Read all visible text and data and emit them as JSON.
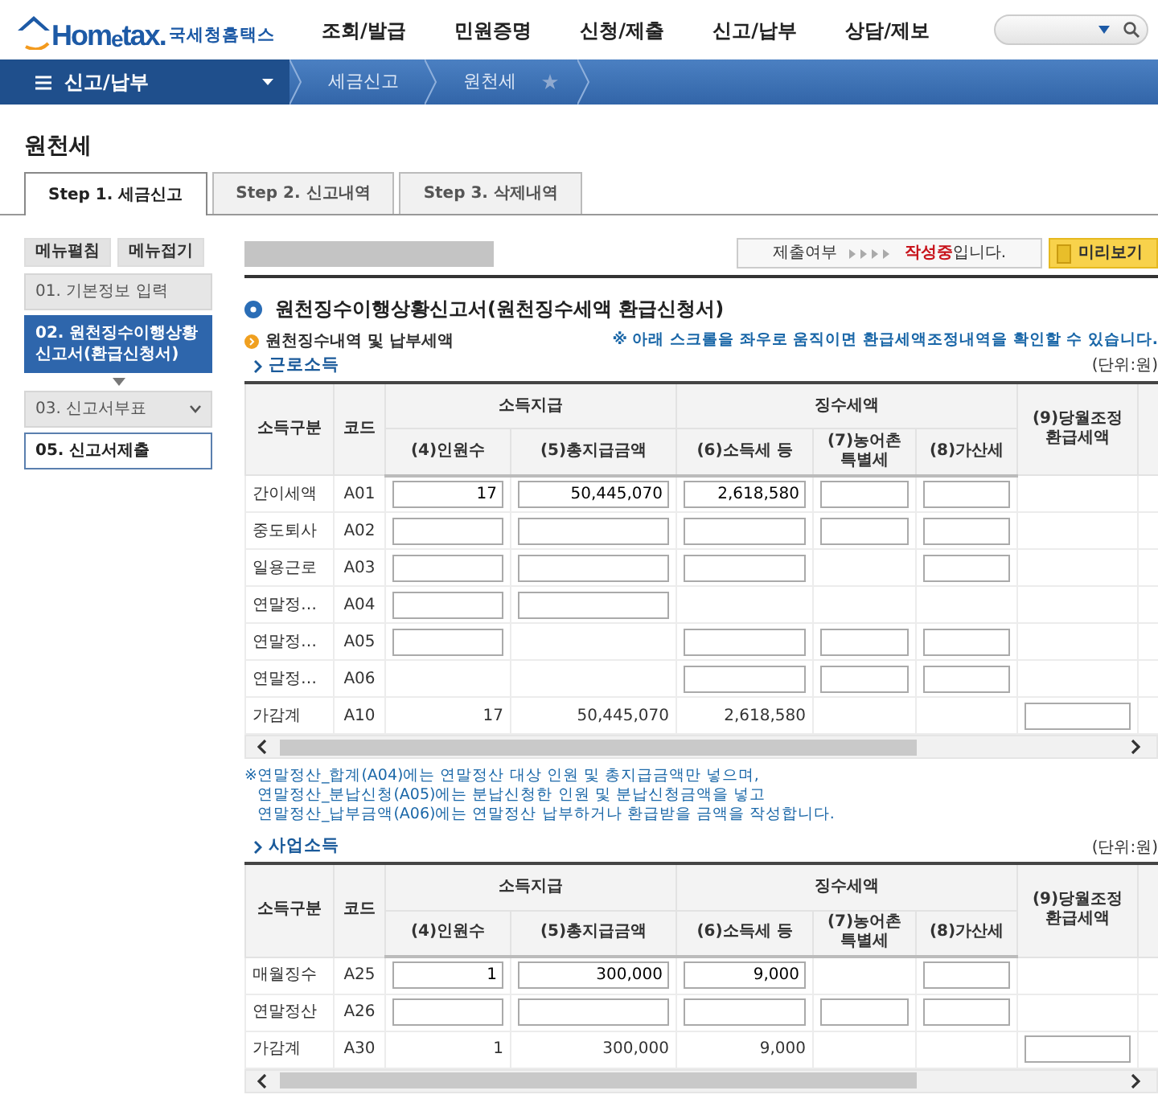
{
  "header": {
    "logo": {
      "brand": "Hom",
      "brand_low": "e",
      "brand_end": "tax.",
      "name": "국세청홈택스"
    },
    "nav": [
      "조회/발급",
      "민원증명",
      "신청/제출",
      "신고/납부",
      "상담/제보"
    ]
  },
  "menu_bar": {
    "current": "신고/납부",
    "breadcrumbs": [
      "세금신고",
      "원천세"
    ]
  },
  "page_title": "원천세",
  "tabs": [
    {
      "label": "Step 1. 세금신고",
      "selected": true
    },
    {
      "label": "Step 2. 신고내역",
      "selected": false
    },
    {
      "label": "Step 3. 삭제내역",
      "selected": false
    }
  ],
  "sidebar": {
    "buttons": [
      "메뉴펼침",
      "메뉴접기"
    ],
    "items": [
      {
        "label": "01. 기본정보 입력",
        "kind": "plain",
        "selected": false
      },
      {
        "label": "02. 원천징수이행상황신고서(환급신청서)",
        "kind": "plain",
        "selected": true
      },
      {
        "label": "03. 신고서부표",
        "kind": "dropdown",
        "selected": false
      },
      {
        "label": "05. 신고서제출",
        "kind": "outlined",
        "selected": false
      }
    ]
  },
  "status": {
    "label": "제출여부",
    "value": "**작성중**입니다."
  },
  "preview_button": "미리보기",
  "form_title": "원천징수이행상황신고서(원천징수세액 환급신청서)",
  "subheading": "원천징수내역 및 납부세액",
  "scroll_hint": "※ 아래 스크롤을 좌우로 움직이면 환급세액조정내역을 확인할 수 있습니다.",
  "tables": [
    {
      "title": "근로소득",
      "unit": "(단위:원)",
      "header": {
        "category": "소득구분",
        "code": "코드",
        "group_paid": "소득지급",
        "group_tax": "징수세액",
        "columns": [
          "(4)인원수",
          "(5)총지급금액",
          "(6)소득세 등",
          "(7)농어촌 특별세",
          "(8)가산세",
          "(9)당월조정 환급세액"
        ]
      },
      "rows": [
        {
          "label": "간이세액",
          "code": "A01",
          "cells": [
            {
              "kind": "field",
              "value": "17"
            },
            {
              "kind": "field",
              "value": "50,445,070"
            },
            {
              "kind": "field",
              "value": "2,618,580"
            },
            {
              "kind": "field"
            },
            {
              "kind": "field"
            },
            {
              "kind": "blank"
            }
          ]
        },
        {
          "label": "중도퇴사",
          "code": "A02",
          "cells": [
            {
              "kind": "field"
            },
            {
              "kind": "field"
            },
            {
              "kind": "field"
            },
            {
              "kind": "field"
            },
            {
              "kind": "field"
            },
            {
              "kind": "blank"
            }
          ]
        },
        {
          "label": "일용근로",
          "code": "A03",
          "cells": [
            {
              "kind": "field"
            },
            {
              "kind": "field"
            },
            {
              "kind": "field"
            },
            {
              "kind": "blank"
            },
            {
              "kind": "field"
            },
            {
              "kind": "blank"
            }
          ]
        },
        {
          "label": "연말정…",
          "code": "A04",
          "cells": [
            {
              "kind": "field"
            },
            {
              "kind": "field"
            },
            {
              "kind": "blank"
            },
            {
              "kind": "blank"
            },
            {
              "kind": "blank"
            },
            {
              "kind": "blank"
            }
          ]
        },
        {
          "label": "연말정…",
          "code": "A05",
          "cells": [
            {
              "kind": "field"
            },
            {
              "kind": "blank"
            },
            {
              "kind": "field"
            },
            {
              "kind": "field"
            },
            {
              "kind": "field"
            },
            {
              "kind": "blank"
            }
          ]
        },
        {
          "label": "연말정…",
          "code": "A06",
          "cells": [
            {
              "kind": "blank"
            },
            {
              "kind": "blank"
            },
            {
              "kind": "field"
            },
            {
              "kind": "field"
            },
            {
              "kind": "field"
            },
            {
              "kind": "blank"
            }
          ]
        },
        {
          "label": "가감계",
          "code": "A10",
          "cells": [
            {
              "kind": "text",
              "value": "17"
            },
            {
              "kind": "text",
              "value": "50,445,070"
            },
            {
              "kind": "text",
              "value": "2,618,580"
            },
            {
              "kind": "blank"
            },
            {
              "kind": "blank"
            },
            {
              "kind": "field"
            }
          ]
        }
      ],
      "notes": {
        "mark": "※",
        "lines": [
          "연말정산_합계(A04)에는 연말정산 대상 인원 및 총지급금액만 넣으며,",
          "연말정산_분납신청(A05)에는 분납신청한 인원 및 분납신청금액을 넣고",
          "연말정산_납부금액(A06)에는 연말정산 납부하거나 환급받을 금액을 작성합니다."
        ]
      }
    },
    {
      "title": "사업소득",
      "unit": "(단위:원)",
      "header": {
        "category": "소득구분",
        "code": "코드",
        "group_paid": "소득지급",
        "group_tax": "징수세액",
        "columns": [
          "(4)인원수",
          "(5)총지급금액",
          "(6)소득세 등",
          "(7)농어촌 특별세",
          "(8)가산세",
          "(9)당월조정 환급세액"
        ]
      },
      "rows": [
        {
          "label": "매월징수",
          "code": "A25",
          "cells": [
            {
              "kind": "field",
              "value": "1"
            },
            {
              "kind": "field",
              "value": "300,000"
            },
            {
              "kind": "field",
              "value": "9,000"
            },
            {
              "kind": "blank"
            },
            {
              "kind": "field"
            },
            {
              "kind": "blank"
            }
          ]
        },
        {
          "label": "연말정산",
          "code": "A26",
          "cells": [
            {
              "kind": "field"
            },
            {
              "kind": "field"
            },
            {
              "kind": "field"
            },
            {
              "kind": "field"
            },
            {
              "kind": "field"
            },
            {
              "kind": "blank"
            }
          ]
        },
        {
          "label": "가감계",
          "code": "A30",
          "cells": [
            {
              "kind": "text",
              "value": "1"
            },
            {
              "kind": "text",
              "value": "300,000"
            },
            {
              "kind": "text",
              "value": "9,000"
            },
            {
              "kind": "blank"
            },
            {
              "kind": "blank"
            },
            {
              "kind": "field"
            }
          ]
        }
      ]
    }
  ]
}
